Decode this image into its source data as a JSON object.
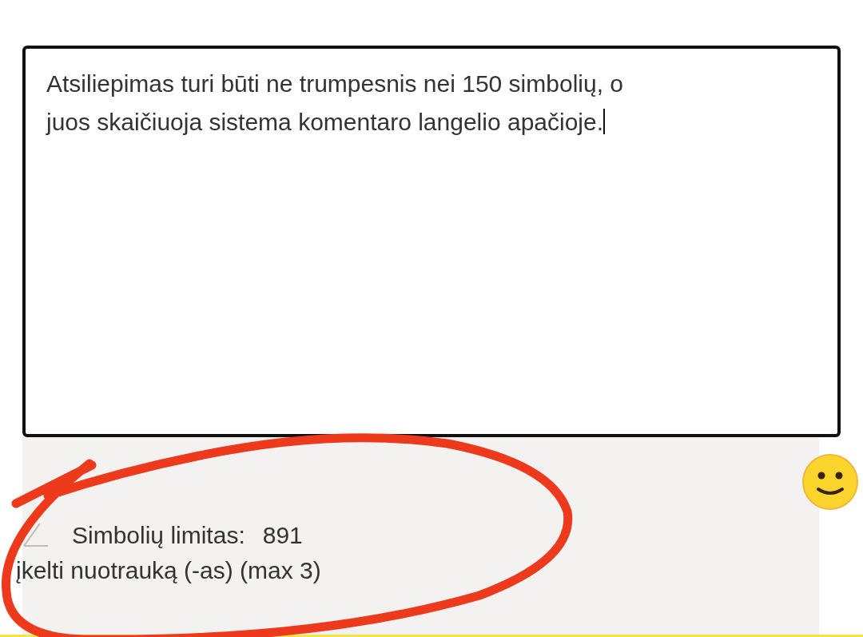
{
  "comment": {
    "value": "Atsiliepimas turi būti ne trumpesnis nei 150 simbolių, o juos skaičiuoja sistema komentaro langelio apačioje.",
    "focused": true
  },
  "char_limit": {
    "label": "Simbolių limitas:",
    "count": "891"
  },
  "upload": {
    "label": "įkelti nuotrauką (-as) (max 3)"
  }
}
